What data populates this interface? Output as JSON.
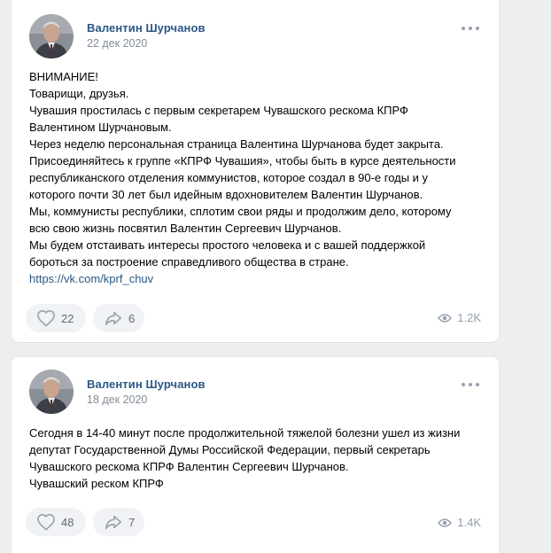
{
  "posts": [
    {
      "author": "Валентин Шурчанов",
      "date": "22 дек 2020",
      "lines": [
        "ВНИМАНИЕ!",
        "Товарищи, друзья.",
        "Чувашия простилась с первым секретарем Чувашского рескома КПРФ",
        "Валентином Шурчановым.",
        "Через неделю персональная страница Валентина Шурчанова будет закрыта.",
        "Присоединяйтесь к группе «КПРФ Чувашия», чтобы быть в курсе деятельности",
        "республиканского отделения коммунистов, которое создал в 90-е годы и у",
        "которого почти 30 лет был идейным вдохновителем Валентин Шурчанов.",
        "Мы, коммунисты республики, сплотим свои ряды и продолжим дело, которому",
        "всю свою жизнь посвятил Валентин Сергеевич Шурчанов.",
        "Мы будем отстаивать интересы простого человека и с вашей поддержкой",
        "бороться за построение справедливого общества в стране."
      ],
      "link": "https://vk.com/kprf_chuv",
      "likes": "22",
      "shares": "6",
      "views": "1.2K"
    },
    {
      "author": "Валентин Шурчанов",
      "date": "18 дек 2020",
      "lines": [
        "Сегодня в 14-40 минут после продолжительной тяжелой болезни ушел из жизни",
        "депутат Государственной Думы Российской Федерации, первый секретарь",
        "Чувашского рескома КПРФ Валентин Сергеевич Шурчанов.",
        "Чувашский реском КПРФ"
      ],
      "likes": "48",
      "shares": "7",
      "views": "1.4K"
    }
  ],
  "icons": {
    "like": "heart-icon",
    "share": "share-arrow-icon",
    "views": "eye-icon",
    "more": "more-dots-icon"
  },
  "colors": {
    "background": "#edeef0",
    "link": "#2a5885",
    "meta": "#818c99",
    "button_bg": "#f0f2f5"
  }
}
